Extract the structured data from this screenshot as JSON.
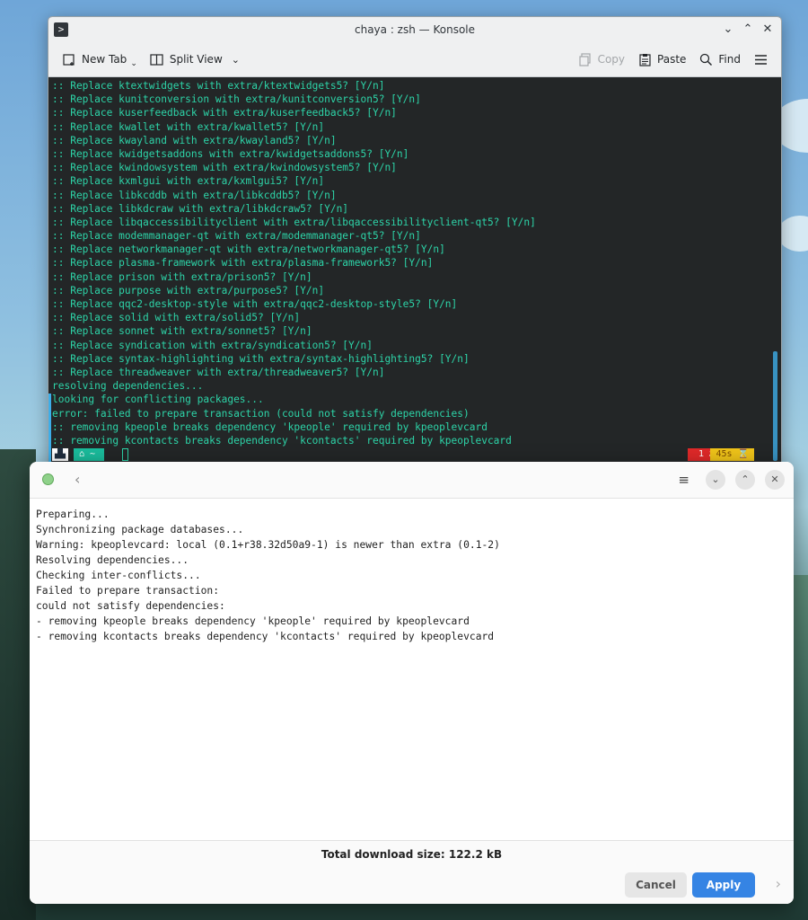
{
  "konsole": {
    "title": "chaya : zsh — Konsole",
    "toolbar": {
      "new_tab": "New Tab",
      "split_view": "Split View",
      "copy": "Copy",
      "paste": "Paste",
      "find": "Find"
    },
    "terminal_lines": [
      ":: Replace ktextwidgets with extra/ktextwidgets5? [Y/n]",
      ":: Replace kunitconversion with extra/kunitconversion5? [Y/n]",
      ":: Replace kuserfeedback with extra/kuserfeedback5? [Y/n]",
      ":: Replace kwallet with extra/kwallet5? [Y/n]",
      ":: Replace kwayland with extra/kwayland5? [Y/n]",
      ":: Replace kwidgetsaddons with extra/kwidgetsaddons5? [Y/n]",
      ":: Replace kwindowsystem with extra/kwindowsystem5? [Y/n]",
      ":: Replace kxmlgui with extra/kxmlgui5? [Y/n]",
      ":: Replace libkcddb with extra/libkcddb5? [Y/n]",
      ":: Replace libkdcraw with extra/libkdcraw5? [Y/n]",
      ":: Replace libqaccessibilityclient with extra/libqaccessibilityclient-qt5? [Y/n]",
      ":: Replace modemmanager-qt with extra/modemmanager-qt5? [Y/n]",
      ":: Replace networkmanager-qt with extra/networkmanager-qt5? [Y/n]",
      ":: Replace plasma-framework with extra/plasma-framework5? [Y/n]",
      ":: Replace prison with extra/prison5? [Y/n]",
      ":: Replace purpose with extra/purpose5? [Y/n]",
      ":: Replace qqc2-desktop-style with extra/qqc2-desktop-style5? [Y/n]",
      ":: Replace solid with extra/solid5? [Y/n]",
      ":: Replace sonnet with extra/sonnet5? [Y/n]",
      ":: Replace syndication with extra/syndication5? [Y/n]",
      ":: Replace syntax-highlighting with extra/syntax-highlighting5? [Y/n]",
      ":: Replace threadweaver with extra/threadweaver5? [Y/n]",
      "resolving dependencies...",
      "looking for conflicting packages...",
      "error: failed to prepare transaction (could not satisfy dependencies)",
      ":: removing kpeople breaks dependency 'kpeople' required by kpeoplevcard",
      ":: removing kcontacts breaks dependency 'kcontacts' required by kpeoplevcard"
    ],
    "prompt": {
      "dir": "~",
      "error": "1 ✘",
      "time": "45s"
    }
  },
  "dialog": {
    "log_lines": [
      "Preparing...",
      "Synchronizing package databases...",
      "Warning: kpeoplevcard: local (0.1+r38.32d50a9-1) is newer than extra (0.1-2)",
      "Resolving dependencies...",
      "Checking inter-conflicts...",
      "Failed to prepare transaction:",
      "could not satisfy dependencies:",
      "- removing kpeople breaks dependency 'kpeople' required by kpeoplevcard",
      "- removing kcontacts breaks dependency 'kcontacts' required by kpeoplevcard"
    ],
    "total_download": "Total download size: 122.2 kB",
    "cancel_label": "Cancel",
    "apply_label": "Apply"
  },
  "colors": {
    "terminal_text": "#2dd4a8",
    "terminal_bg": "#232627",
    "accent": "#3584e4",
    "prompt_error": "#e02929",
    "prompt_time": "#f0c419"
  },
  "icons": [
    "konsole-icon",
    "new-tab-icon",
    "split-view-icon",
    "copy-icon",
    "paste-icon",
    "find-icon",
    "hamburger-menu-icon",
    "arch-logo-icon",
    "home-icon",
    "hourglass-icon",
    "pamac-icon",
    "back-arrow-icon",
    "minimize-icon",
    "maximize-icon",
    "close-icon",
    "forward-arrow-icon"
  ]
}
